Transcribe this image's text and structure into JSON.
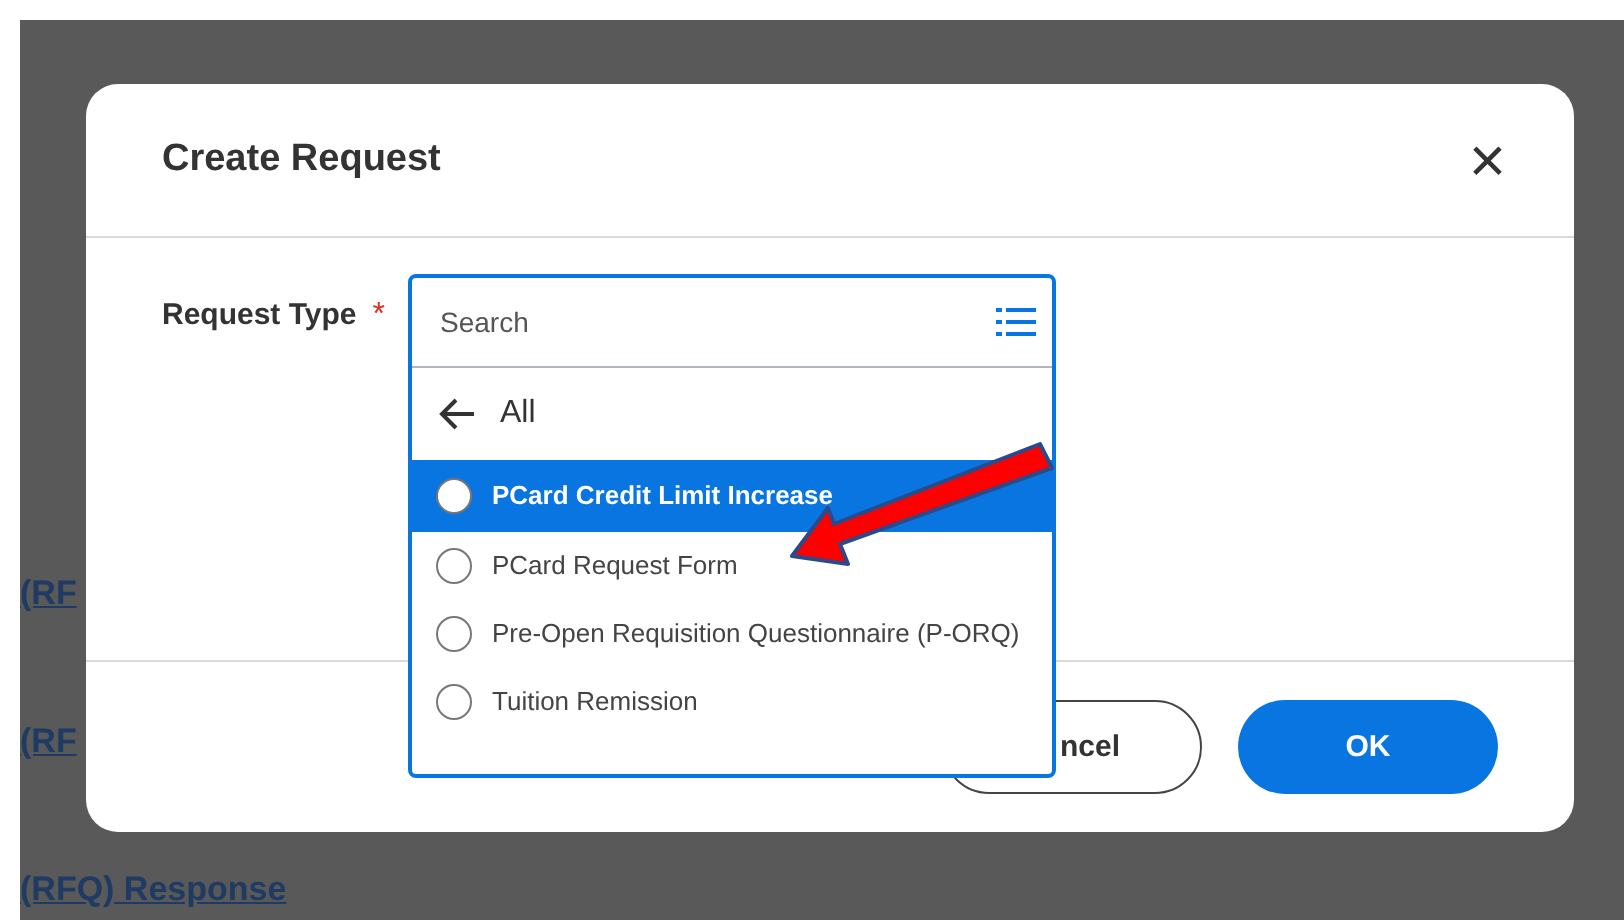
{
  "background_links": [
    "(RF",
    "(RF",
    "(RFQ) Response"
  ],
  "dialog": {
    "title": "Create Request",
    "close": "×",
    "field": {
      "label": "Request Type",
      "required_mark": "*"
    },
    "dropdown": {
      "placeholder": "Search",
      "back_label": "All",
      "options": [
        {
          "label": "PCard Credit Limit Increase",
          "selected": true
        },
        {
          "label": "PCard Request Form",
          "selected": false
        },
        {
          "label": "Pre-Open Requisition Questionnaire (P-ORQ)",
          "selected": false
        },
        {
          "label": "Tuition Remission",
          "selected": false
        }
      ]
    },
    "buttons": [
      {
        "kind": "secondary",
        "label": "ncel"
      },
      {
        "kind": "primary",
        "label": "OK"
      }
    ]
  }
}
